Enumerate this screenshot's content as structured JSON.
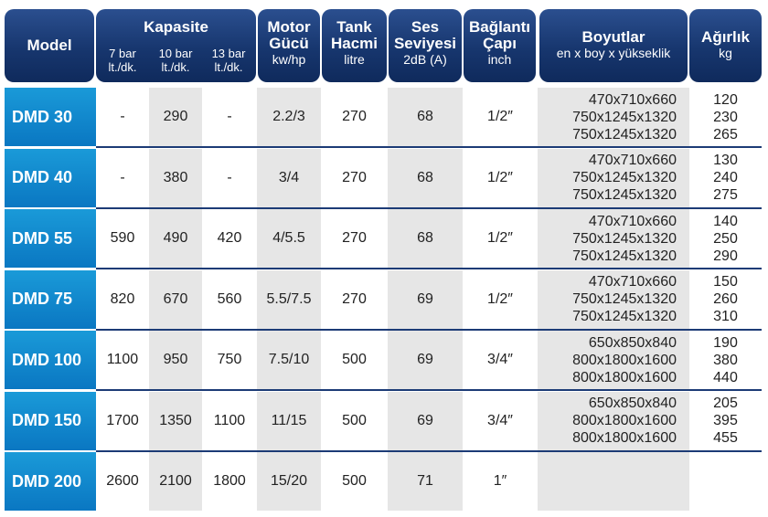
{
  "header": {
    "model": "Model",
    "kapasite": "Kapasite",
    "kap_7": "7 bar\nlt./dk.",
    "kap_10": "10 bar\nlt./dk.",
    "kap_13": "13 bar\nlt./dk.",
    "motor_1": "Motor",
    "motor_2": "Gücü",
    "motor_3": "kw/hp",
    "tank_1": "Tank",
    "tank_2": "Hacmi",
    "tank_3": "litre",
    "ses_1": "Ses",
    "ses_2": "Seviyesi",
    "ses_3": "2dB (A)",
    "bag_1": "Bağlantı",
    "bag_2": "Çapı",
    "bag_3": "inch",
    "boy_1": "Boyutlar",
    "boy_2": "en x boy x yükseklik",
    "agr_1": "Ağırlık",
    "agr_2": "kg"
  },
  "rows": [
    {
      "model": "DMD 30",
      "k7": "-",
      "k10": "290",
      "k13": "-",
      "motor": "2.2/3",
      "tank": "270",
      "ses": "68",
      "bag": "1/2″",
      "boy": [
        "470x710x660",
        "750x1245x1320",
        "750x1245x1320"
      ],
      "agr": [
        "120",
        "230",
        "265"
      ]
    },
    {
      "model": "DMD 40",
      "k7": "-",
      "k10": "380",
      "k13": "-",
      "motor": "3/4",
      "tank": "270",
      "ses": "68",
      "bag": "1/2″",
      "boy": [
        "470x710x660",
        "750x1245x1320",
        "750x1245x1320"
      ],
      "agr": [
        "130",
        "240",
        "275"
      ]
    },
    {
      "model": "DMD 55",
      "k7": "590",
      "k10": "490",
      "k13": "420",
      "motor": "4/5.5",
      "tank": "270",
      "ses": "68",
      "bag": "1/2″",
      "boy": [
        "470x710x660",
        "750x1245x1320",
        "750x1245x1320"
      ],
      "agr": [
        "140",
        "250",
        "290"
      ]
    },
    {
      "model": "DMD 75",
      "k7": "820",
      "k10": "670",
      "k13": "560",
      "motor": "5.5/7.5",
      "tank": "270",
      "ses": "69",
      "bag": "1/2″",
      "boy": [
        "470x710x660",
        "750x1245x1320",
        "750x1245x1320"
      ],
      "agr": [
        "150",
        "260",
        "310"
      ]
    },
    {
      "model": "DMD 100",
      "k7": "1100",
      "k10": "950",
      "k13": "750",
      "motor": "7.5/10",
      "tank": "500",
      "ses": "69",
      "bag": "3/4″",
      "boy": [
        "650x850x840",
        "800x1800x1600",
        "800x1800x1600"
      ],
      "agr": [
        "190",
        "380",
        "440"
      ]
    },
    {
      "model": "DMD 150",
      "k7": "1700",
      "k10": "1350",
      "k13": "1100",
      "motor": "11/15",
      "tank": "500",
      "ses": "69",
      "bag": "3/4″",
      "boy": [
        "650x850x840",
        "800x1800x1600",
        "800x1800x1600"
      ],
      "agr": [
        "205",
        "395",
        "455"
      ]
    },
    {
      "model": "DMD 200",
      "k7": "2600",
      "k10": "2100",
      "k13": "1800",
      "motor": "15/20",
      "tank": "500",
      "ses": "71",
      "bag": "1″",
      "boy": [],
      "agr": []
    }
  ]
}
